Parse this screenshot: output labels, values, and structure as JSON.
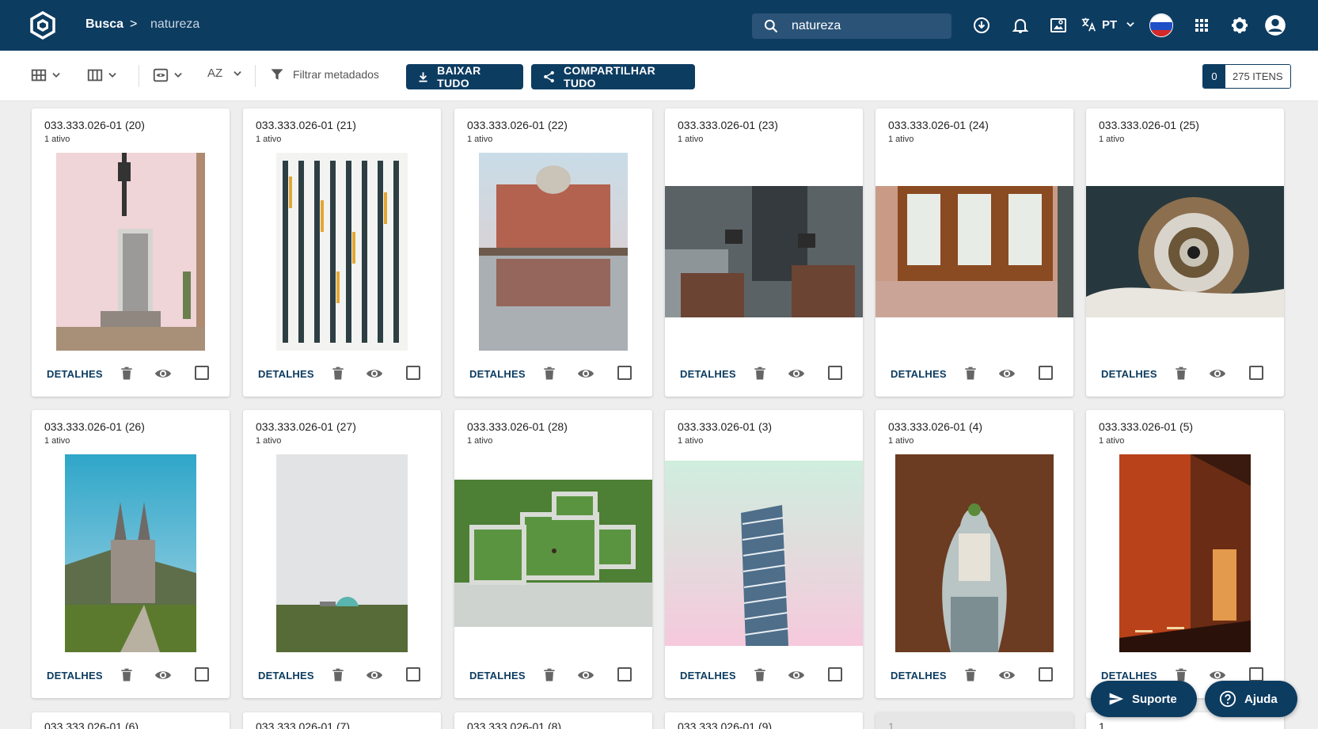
{
  "header": {
    "breadcrumb_root": "Busca",
    "breadcrumb_sep": ">",
    "breadcrumb_current": "natureza",
    "search_value": "natureza",
    "language": "PT",
    "icons": [
      "download-icon",
      "bell-icon",
      "image-search-icon",
      "translate-icon",
      "flag-icon",
      "apps-icon",
      "gear-icon",
      "account-icon"
    ]
  },
  "toolbar": {
    "filter_label": "Filtrar metadados",
    "sort_label": "AZ",
    "download_all": "BAIXAR TUDO",
    "share_all": "COMPARTILHAR TUDO",
    "selected_count": "0",
    "total_label": "275 ITENS"
  },
  "cards_row1": [
    {
      "title": "033.333.026-01 (20)",
      "sub": "1 ativo",
      "action": "DETALHES"
    },
    {
      "title": "033.333.026-01 (21)",
      "sub": "1 ativo",
      "action": "DETALHES"
    },
    {
      "title": "033.333.026-01 (22)",
      "sub": "1 ativo",
      "action": "DETALHES"
    },
    {
      "title": "033.333.026-01 (23)",
      "sub": "1 ativo",
      "action": "DETALHES"
    },
    {
      "title": "033.333.026-01 (24)",
      "sub": "1 ativo",
      "action": "DETALHES"
    },
    {
      "title": "033.333.026-01 (25)",
      "sub": "1 ativo",
      "action": "DETALHES"
    }
  ],
  "cards_row2": [
    {
      "title": "033.333.026-01 (26)",
      "sub": "1 ativo",
      "action": "DETALHES"
    },
    {
      "title": "033.333.026-01 (27)",
      "sub": "1 ativo",
      "action": "DETALHES"
    },
    {
      "title": "033.333.026-01 (28)",
      "sub": "1 ativo",
      "action": "DETALHES"
    },
    {
      "title": "033.333.026-01 (3)",
      "sub": "1 ativo",
      "action": "DETALHES"
    },
    {
      "title": "033.333.026-01 (4)",
      "sub": "1 ativo",
      "action": "DETALHES"
    },
    {
      "title": "033.333.026-01 (5)",
      "sub": "1 ativo",
      "action": "DETALHES"
    }
  ],
  "cards_row3": [
    {
      "title": "033.333.026-01 (6)"
    },
    {
      "title": "033.333.026-01 (7)"
    },
    {
      "title": "033.333.026-01 (8)"
    },
    {
      "title": "033.333.026-01 (9)"
    },
    {
      "title": "1"
    },
    {
      "title": "1"
    }
  ],
  "floating": {
    "support": "Suporte",
    "help": "Ajuda"
  },
  "colors": {
    "primary": "#0d3c61",
    "background": "#eeeeee"
  }
}
